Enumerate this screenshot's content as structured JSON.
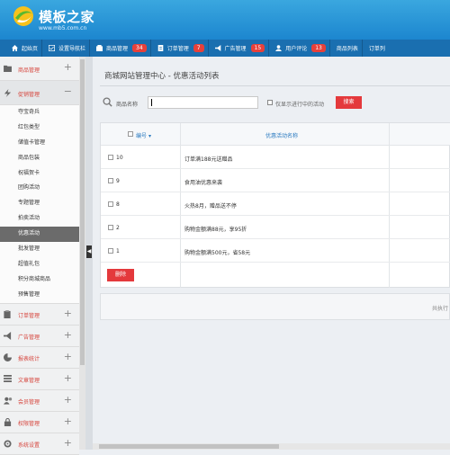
{
  "header": {
    "logo_text": "模板之家",
    "logo_url": "www.mb5.com.cn"
  },
  "topnav": {
    "items": [
      {
        "label": "起始页",
        "icon": "home-icon"
      },
      {
        "label": "设置导航栏",
        "icon": "checkbox-icon"
      },
      {
        "label": "商品管理",
        "icon": "product-icon",
        "badge": "34"
      },
      {
        "label": "订单管理",
        "icon": "order-icon",
        "badge": "7"
      },
      {
        "label": "广告管理",
        "icon": "ad-icon",
        "badge": "15"
      },
      {
        "label": "用户评论",
        "icon": "user-icon",
        "badge": "13"
      },
      {
        "label": "商品列表"
      },
      {
        "label": "订单列"
      }
    ]
  },
  "sidebar": {
    "cat_product": "商品管理",
    "cat_promo": "促销管理",
    "promo_items": [
      "夺宝奇兵",
      "红包类型",
      "储值卡管理",
      "商品包装",
      "祝福贺卡",
      "团购活动",
      "专题管理",
      "拍卖活动",
      "优惠活动",
      "批发管理",
      "超值礼包",
      "积分商城商品",
      "预售管理"
    ],
    "cat_order": "订单管理",
    "cat_ad": "广告管理",
    "cat_report": "报表统计",
    "cat_article": "文章管理",
    "cat_member": "会员管理",
    "cat_permission": "权限管理",
    "cat_system": "系统设置",
    "collapse_arrow": "◀"
  },
  "main": {
    "title": "商城网站管理中心 - 优惠活动列表",
    "search_label": "商品名称",
    "search_value": "",
    "filter_label": "仅显示进行中的活动",
    "search_button": "搜索",
    "col_id": "编号",
    "col_name": "优惠活动名称",
    "rows": [
      {
        "id": "10",
        "name": "订单满188元送赠品"
      },
      {
        "id": "9",
        "name": "食用油优惠来袭"
      },
      {
        "id": "8",
        "name": "火热8月，赠品送不停"
      },
      {
        "id": "2",
        "name": "购物金额满88元，享95折"
      },
      {
        "id": "1",
        "name": "购物金额满500元，省58元"
      }
    ],
    "delete_button": "删除",
    "pager_text": "共执行"
  },
  "colors": {
    "header_blue": "#1c86cf",
    "nav_blue": "#1a6fb0",
    "accent_red": "#e4393c",
    "sidebar_label_red": "#d6453d",
    "active_item_gray": "#6b6b6b"
  }
}
